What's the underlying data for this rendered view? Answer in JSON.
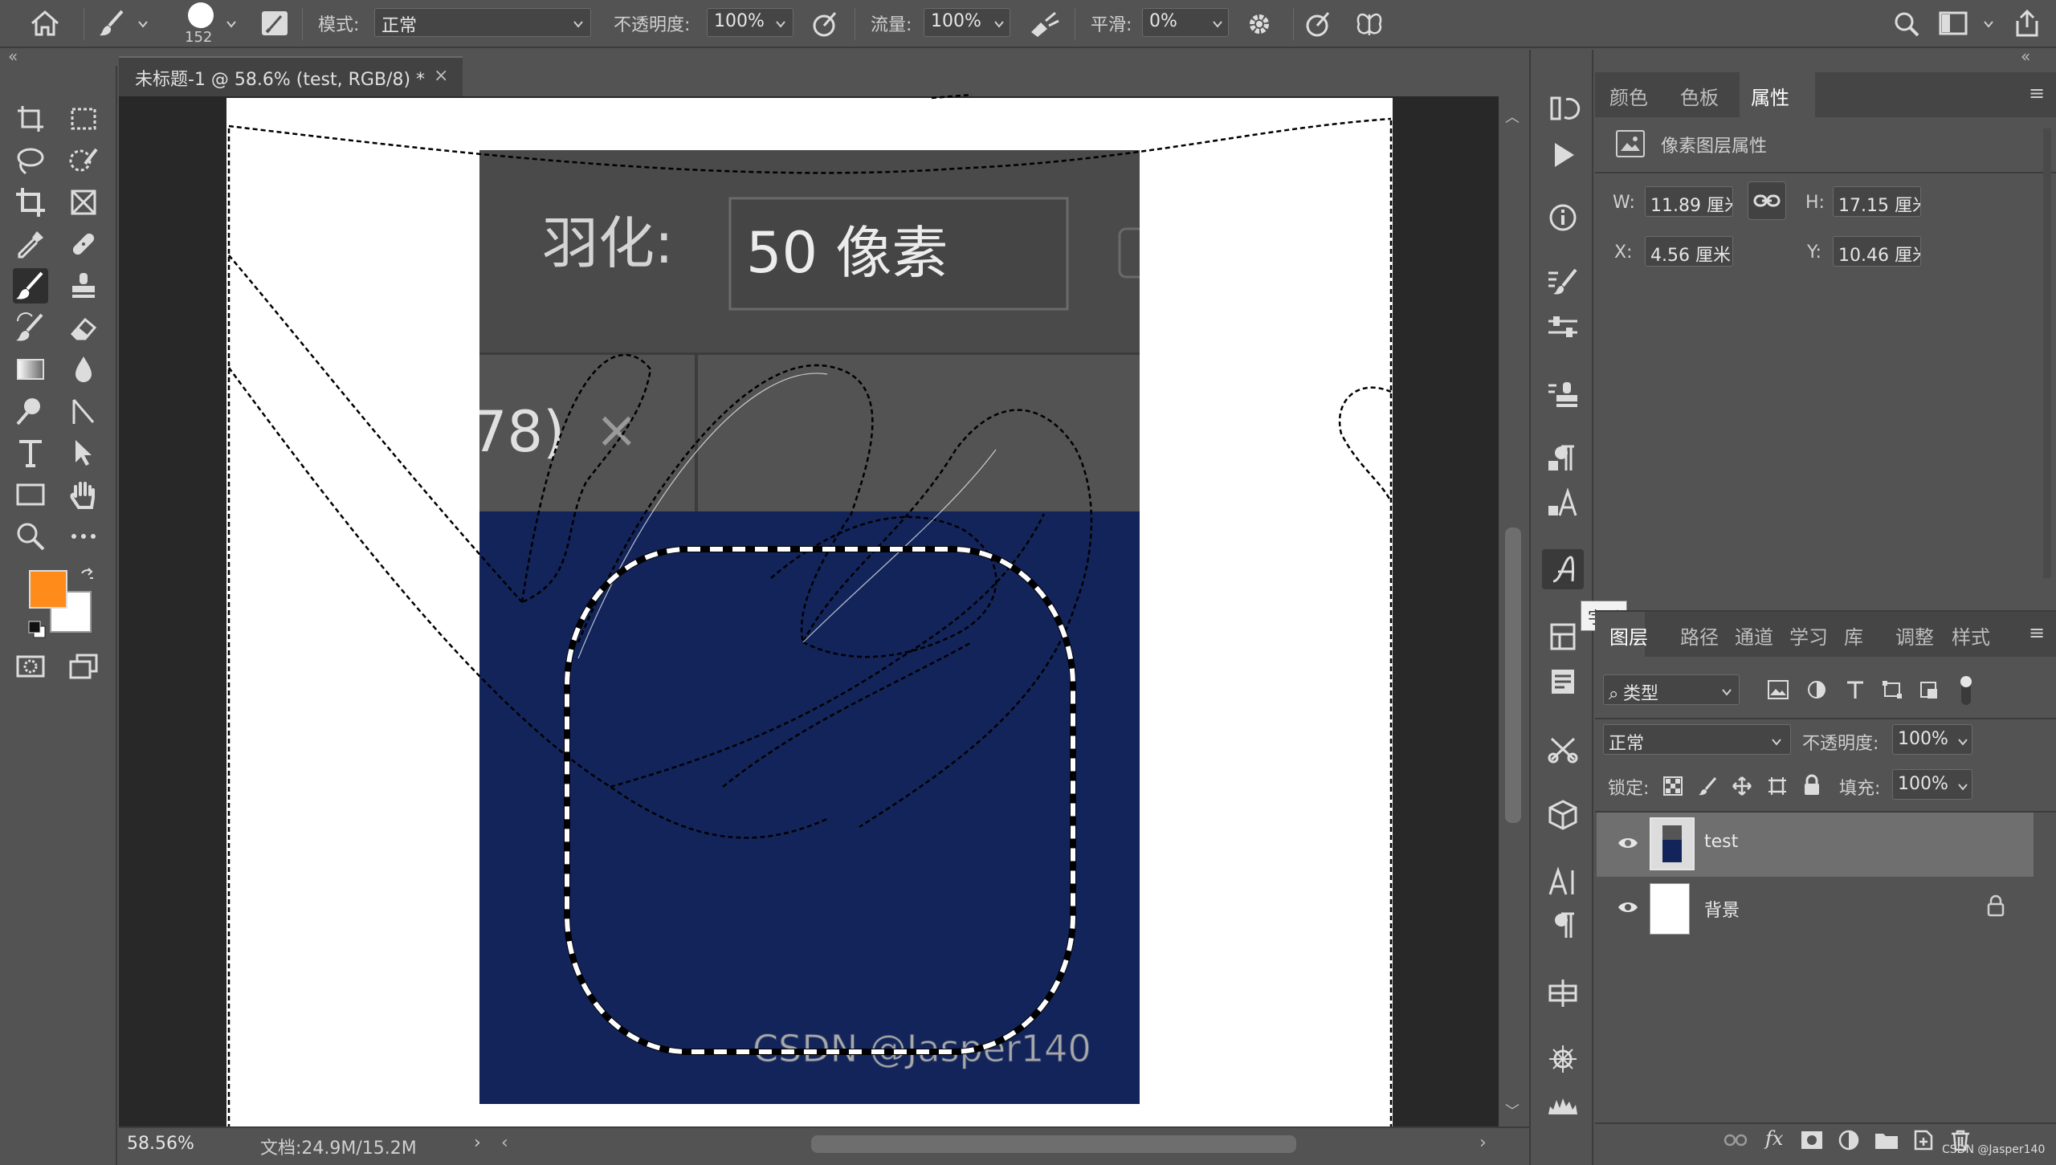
{
  "options_bar": {
    "brush_size": "152",
    "mode_label": "模式:",
    "mode_value": "正常",
    "opacity_label": "不透明度:",
    "opacity_value": "100%",
    "flow_label": "流量:",
    "flow_value": "100%",
    "smoothing_label": "平滑:",
    "smoothing_value": "0%"
  },
  "document_tab": {
    "title": "未标题-1 @ 58.6% (test, RGB/8) *",
    "close": "×"
  },
  "canvas_image": {
    "feather_label": "羽化:",
    "feather_value": "50 像素",
    "tab_fragment": "78)",
    "tab_close": "×",
    "watermark": "CSDN @Jasper140"
  },
  "status_bar": {
    "zoom": "58.56%",
    "doc_size": "文档:24.9M/15.2M"
  },
  "colors": {
    "foreground": "#ff8c1a",
    "background": "#ffffff",
    "panel_bg": "#535353",
    "canvas_navy": "#13245a"
  },
  "properties_panel": {
    "tabs": [
      "颜色",
      "色板",
      "属性"
    ],
    "active_tab": "属性",
    "section_title": "像素图层属性",
    "w_label": "W:",
    "w_value": "11.89 厘米",
    "h_label": "H:",
    "h_value": "17.15 厘米",
    "x_label": "X:",
    "x_value": "4.56 厘米",
    "y_label": "Y:",
    "y_value": "10.46 厘米"
  },
  "tooltip": "字形",
  "layers_panel": {
    "tabs": [
      "图层",
      "路径",
      "通道",
      "学习",
      "库",
      "调整",
      "样式"
    ],
    "active_tab": "图层",
    "filter_value": "类型",
    "blend_mode": "正常",
    "opacity_label": "不透明度:",
    "opacity_value": "100%",
    "lock_label": "锁定:",
    "fill_label": "填充:",
    "fill_value": "100%",
    "layers": [
      {
        "name": "test",
        "selected": true
      },
      {
        "name": "背景",
        "selected": false,
        "locked": true
      }
    ]
  },
  "footer_watermark": "CSDN @Jasper140"
}
